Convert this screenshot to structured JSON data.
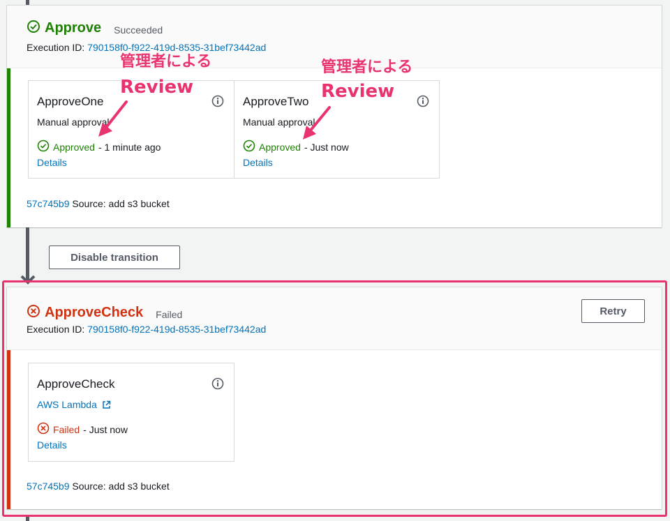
{
  "stages": [
    {
      "title": "Approve",
      "status": "Succeeded",
      "execution_label": "Execution ID:",
      "execution_id": "790158f0-f922-419d-8535-31bef73442ad",
      "status_color": "#1d8102",
      "actions": [
        {
          "name": "ApproveOne",
          "provider": "Manual approval",
          "status": "Approved",
          "time": "- 1 minute ago",
          "details": "Details"
        },
        {
          "name": "ApproveTwo",
          "provider": "Manual approval",
          "status": "Approved",
          "time": "- Just now",
          "details": "Details"
        }
      ],
      "source_commit": "57c745b9",
      "source_text": "Source: add s3 bucket"
    },
    {
      "title": "ApproveCheck",
      "status": "Failed",
      "execution_label": "Execution ID:",
      "execution_id": "790158f0-f922-419d-8535-31bef73442ad",
      "status_color": "#d13212",
      "retry_label": "Retry",
      "actions": [
        {
          "name": "ApproveCheck",
          "provider": "AWS Lambda",
          "status": "Failed",
          "time": "- Just now",
          "details": "Details"
        }
      ],
      "source_commit": "57c745b9",
      "source_text": "Source: add s3 bucket"
    }
  ],
  "transition": {
    "disable_label": "Disable transition"
  },
  "annotations": {
    "line1": "管理者による",
    "line2": "Review",
    "color": "#e8336e"
  },
  "icons": {
    "success": "check-circle-icon",
    "failed": "x-circle-icon",
    "info": "info-icon",
    "external": "external-link-icon"
  }
}
